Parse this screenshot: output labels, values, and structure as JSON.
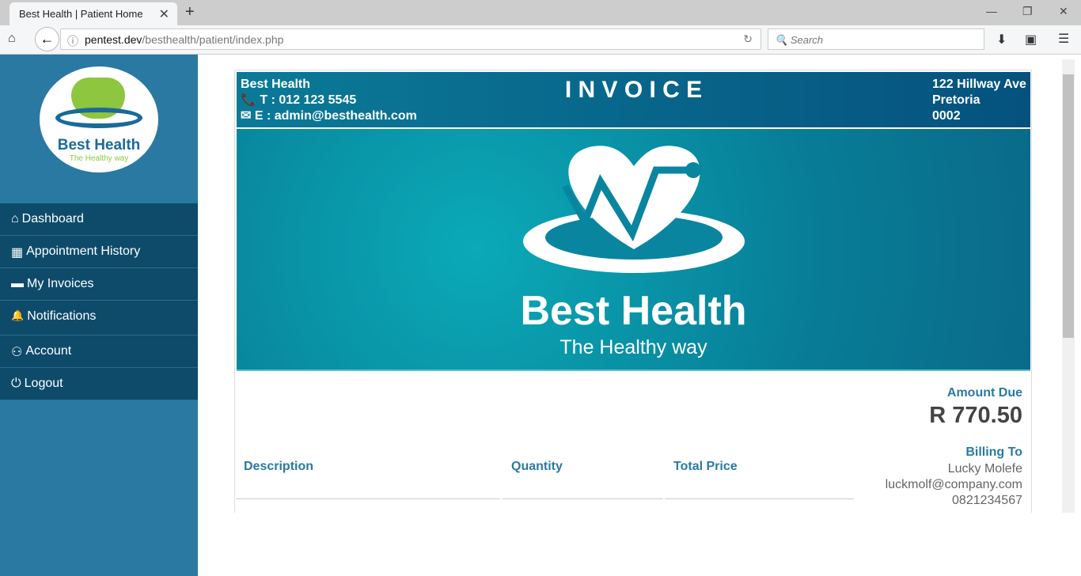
{
  "browser": {
    "tab_title": "Best Health | Patient Home",
    "url_host": "pentest.dev",
    "url_path": "/besthealth/patient/index.php",
    "search_placeholder": "Search"
  },
  "sidebar": {
    "logo_title": "Best Health",
    "logo_tagline": "The Healthy way",
    "items": [
      {
        "icon": "home-icon",
        "label": "Dashboard",
        "glyph": "⌂"
      },
      {
        "icon": "calendar-icon",
        "label": "Appointment History",
        "glyph": "▦"
      },
      {
        "icon": "credit-card-icon",
        "label": "My Invoices",
        "glyph": "▬"
      },
      {
        "icon": "bell-icon",
        "label": "Notifications",
        "glyph": "🔔"
      },
      {
        "icon": "user-icon",
        "label": "Account",
        "glyph": "⚇"
      },
      {
        "icon": "power-icon",
        "label": "Logout",
        "glyph": "⏻"
      }
    ]
  },
  "invoice": {
    "company": "Best Health",
    "phone": "T : 012 123 5545",
    "email": "E : admin@besthealth.com",
    "title": "I N V O I C E",
    "address": [
      "122 Hillway Ave",
      "Pretoria",
      "0002"
    ],
    "banner_title": "Best Health",
    "banner_tagline": "The Healthy way",
    "amount_due_label": "Amount Due",
    "amount_due": "R 770.50",
    "billing_label": "Billing To",
    "billing": [
      "Lucky Molefe",
      "luckmolf@company.com",
      "0821234567"
    ],
    "columns": [
      "Description",
      "Quantity",
      "Total Price"
    ]
  }
}
